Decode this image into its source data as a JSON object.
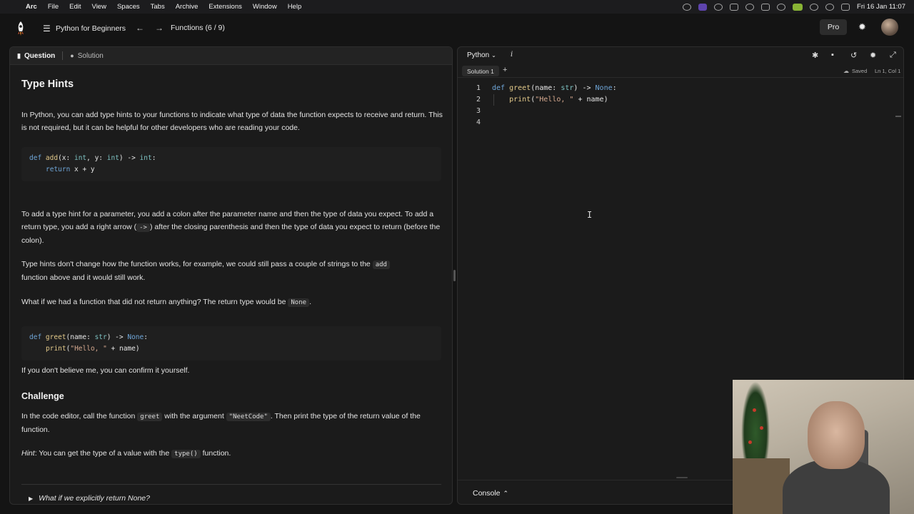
{
  "menubar": {
    "items": [
      "Arc",
      "File",
      "Edit",
      "View",
      "Spaces",
      "Tabs",
      "Archive",
      "Extensions",
      "Window",
      "Help"
    ],
    "datetime": "Fri 16 Jan  11:07"
  },
  "topbar": {
    "course_title": "Python for Beginners",
    "lesson_position": "Functions (6 / 9)",
    "pro_label": "Pro"
  },
  "left": {
    "tabs": {
      "question": "Question",
      "solution": "Solution"
    },
    "title": "Type Hints",
    "p1": "In Python, you can add type hints to your functions to indicate what type of data the function expects to receive and return. This is not required, but it can be helpful for other developers who are reading your code.",
    "code1": {
      "line1": {
        "kw": "def",
        "fn": "add",
        "a": "(x: ",
        "t1": "int",
        "b": ", y: ",
        "t2": "int",
        "c": ") -> ",
        "t3": "int",
        "d": ":"
      },
      "line2": {
        "kw": "return",
        "rest": " x + y"
      }
    },
    "p2a": "To add a type hint for a parameter, you add a colon after the parameter name and then the type of data you expect. To add a return type, you add a right arrow (",
    "p2_code": "->",
    "p2b": ") after the closing parenthesis and then the type of data you expect to return (before the colon).",
    "p3a": "Type hints don't change how the function works, for example, we could still pass a couple of strings to the",
    "p3_code": "add",
    "p3b": "function above and it would still work.",
    "p4a": "What if we had a function that did not return anything? The return type would be",
    "p4_code": "None",
    "p4b": ".",
    "code2": {
      "line1": {
        "kw": "def",
        "fn": "greet",
        "a": "(name: ",
        "t1": "str",
        "b": ") -> ",
        "t2": "None",
        "c": ":"
      },
      "line2": {
        "fn": "print",
        "a": "(",
        "s": "\"Hello, \"",
        "b": " + name)"
      }
    },
    "p5": "If you don't believe me, you can confirm it yourself.",
    "challenge_title": "Challenge",
    "p6a": "In the code editor, call the function",
    "p6_code1": "greet",
    "p6b": "with the argument",
    "p6_code2": "\"NeetCode\"",
    "p6c": ". Then print the type of the return value of the function.",
    "hint_label": "Hint",
    "hint_a": ": You can get the type of a value with the",
    "hint_code": "type()",
    "hint_b": "function.",
    "details_label": "What if we explicitly return None?"
  },
  "editor": {
    "language": "Python",
    "solution_tab": "Solution 1",
    "saved": "Saved",
    "position": "Ln 1, Col 1",
    "line_numbers": [
      "1",
      "2",
      "3",
      "4"
    ],
    "line1": {
      "kw": "def",
      "fn": "greet",
      "a": "(name: ",
      "t1": "str",
      "b": ") -> ",
      "t2": "None",
      "c": ":"
    },
    "line2": {
      "indent": "    ",
      "fn": "print",
      "a": "(",
      "s": "\"Hello, \"",
      "b": " + name)"
    },
    "console_label": "Console"
  },
  "colors": {
    "keyword": "#6fa6d8",
    "function": "#e2c98a",
    "type": "#7cc0c0",
    "string": "#d6a98f"
  }
}
